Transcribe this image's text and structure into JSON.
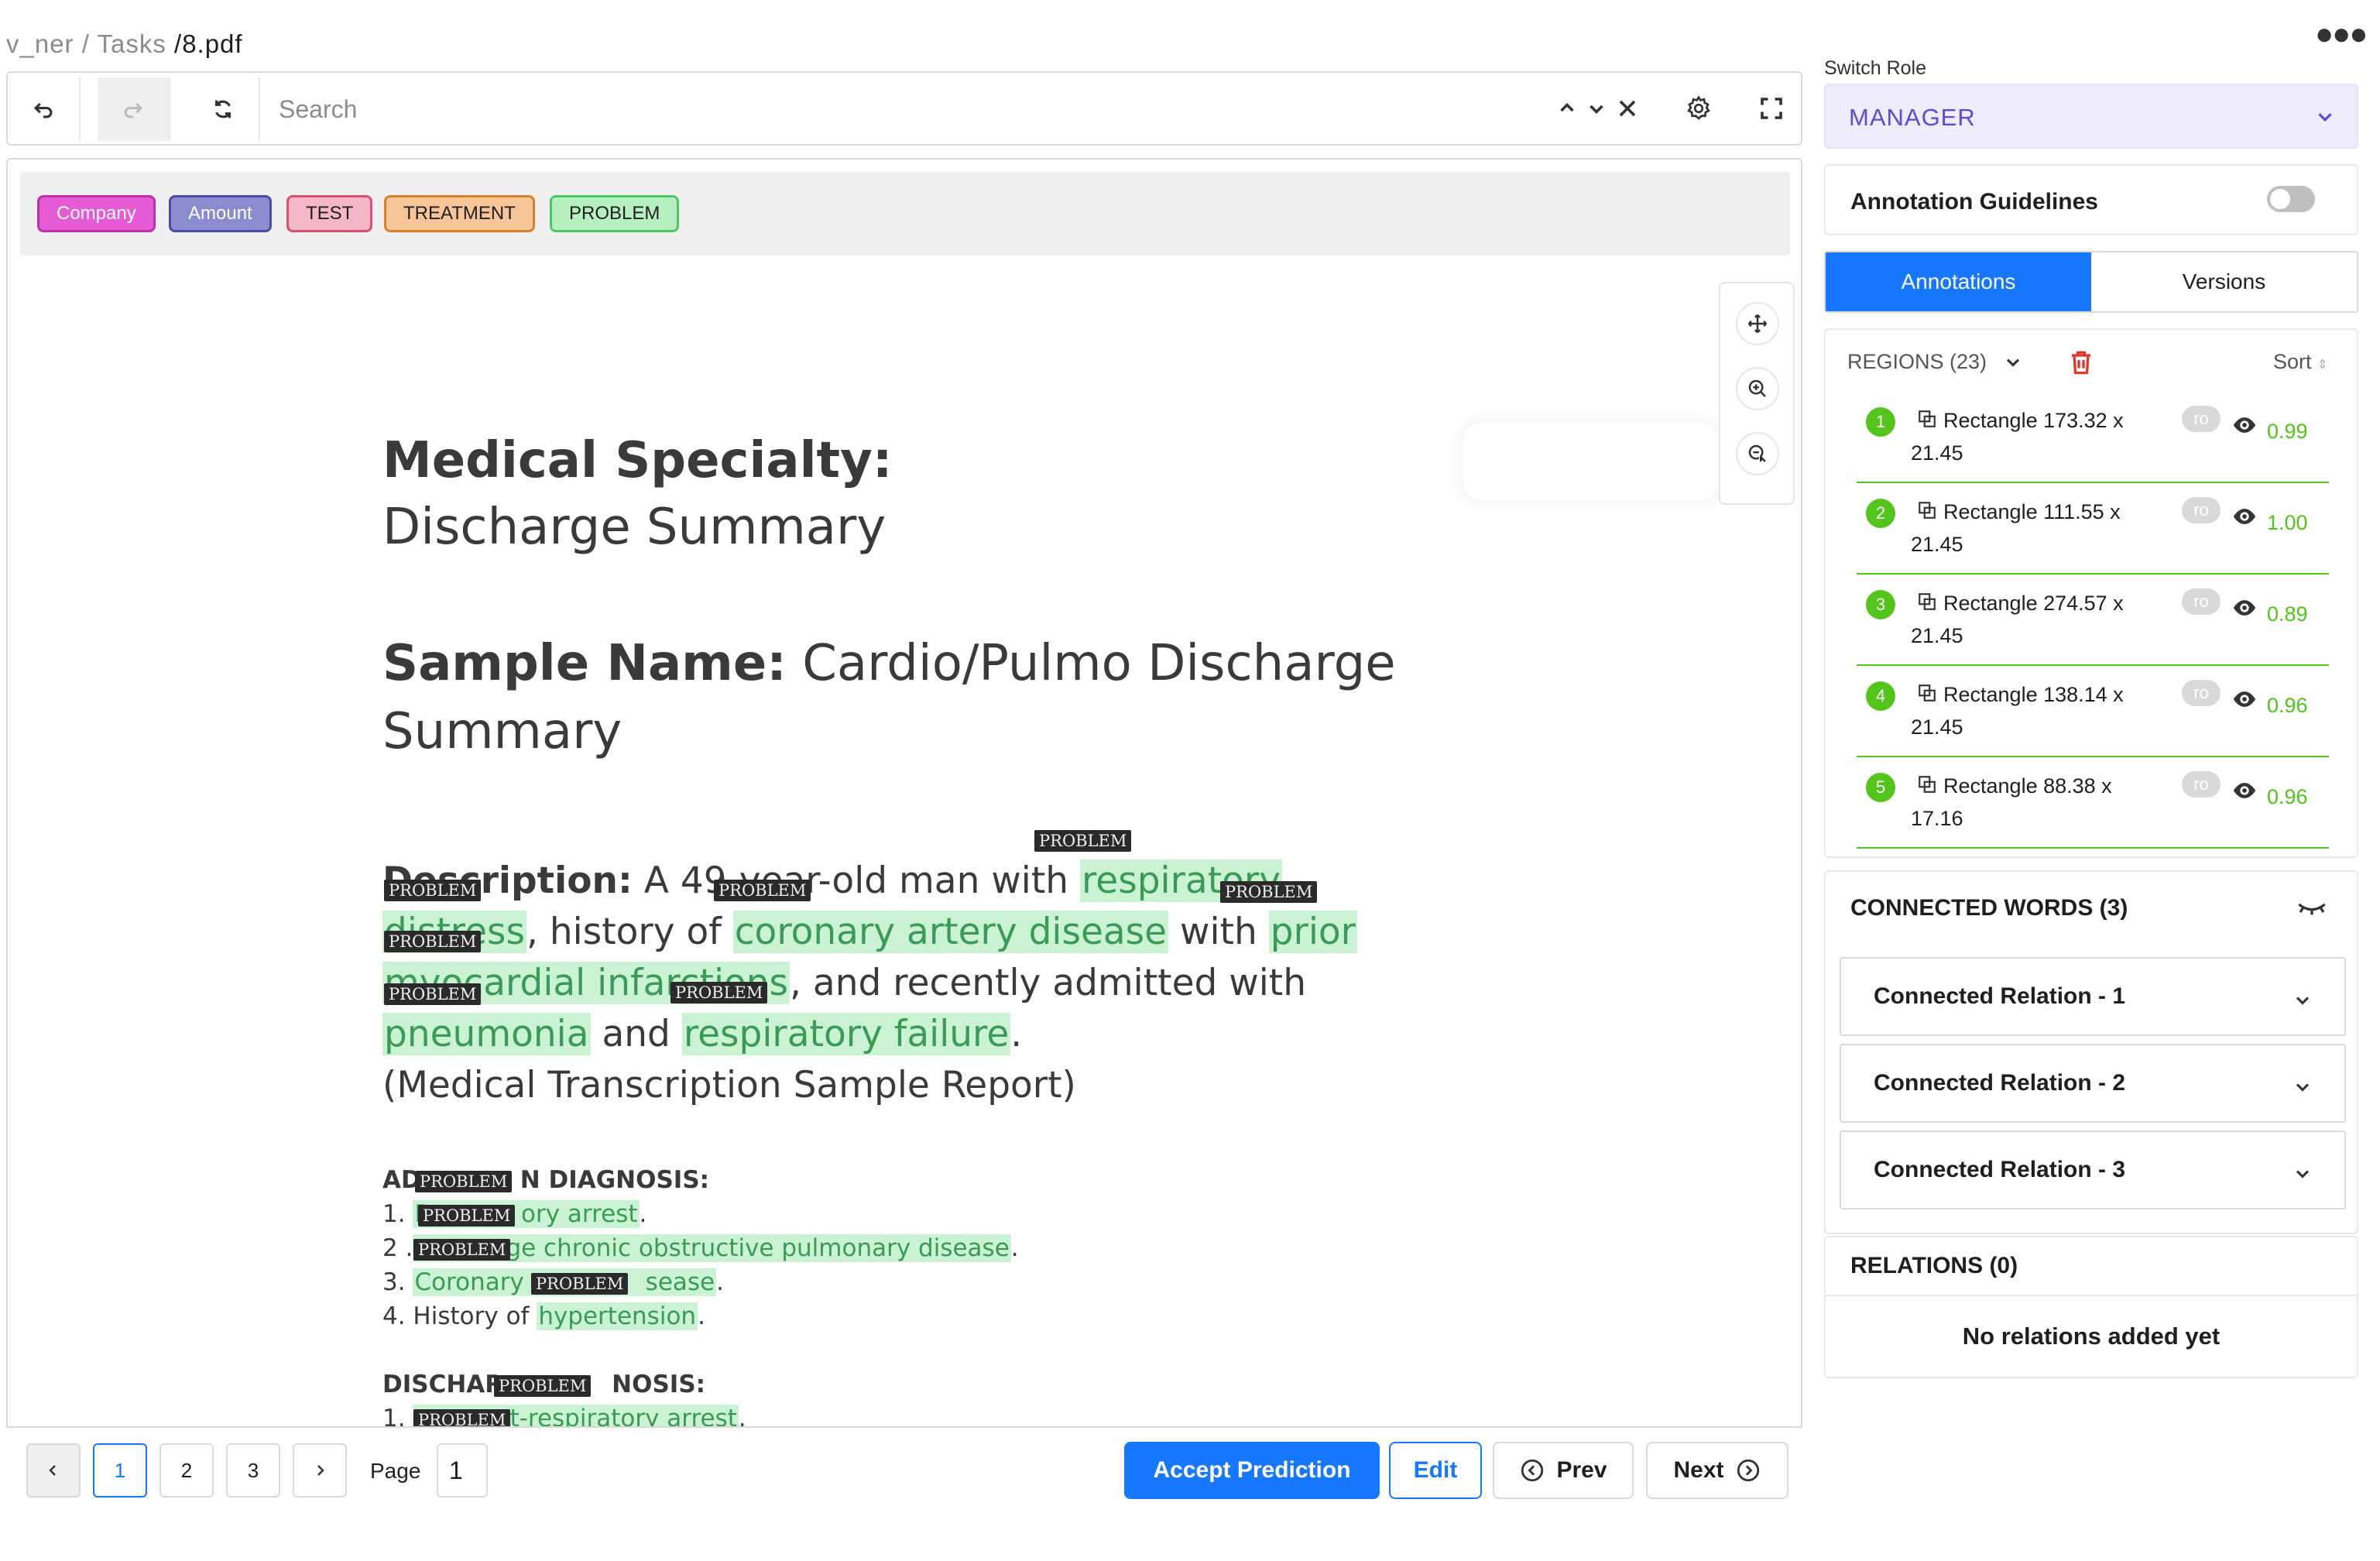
{
  "breadcrumb": {
    "project": "v_ner",
    "sep1": "/",
    "section": "Tasks",
    "sep2": "/",
    "file": "8.pdf"
  },
  "toolbar": {
    "search_placeholder": "Search"
  },
  "labels": [
    {
      "text": "Company",
      "bg": "#e55bd5",
      "border": "#b832a8",
      "color": "#ffffff"
    },
    {
      "text": "Amount",
      "bg": "#8b8bd0",
      "border": "#4b4ba6",
      "color": "#ffffff"
    },
    {
      "text": "TEST",
      "bg": "#f3b7c6",
      "border": "#d9536f",
      "color": "#1f1f1f"
    },
    {
      "text": "TREATMENT",
      "bg": "#f6c699",
      "border": "#d9822b",
      "color": "#1f1f1f"
    },
    {
      "text": "PROBLEM",
      "bg": "#b6f0c0",
      "border": "#4cc766",
      "color": "#1f1f1f"
    }
  ],
  "document": {
    "specialty_label": "Medical Specialty:",
    "specialty_value": "Discharge Summary",
    "sample_label": "Sample Name:",
    "sample_value_1": "Cardio/Pulmo Discharge",
    "sample_value_2": "Summary",
    "desc_label": "Description:",
    "desc_1a": " A 49-year-old man with ",
    "desc_1b": "respiratory",
    "desc_2a": "distress",
    "desc_2b": ", history of ",
    "desc_2c": "coronary artery disease",
    "desc_2d": " with ",
    "desc_2e": "prior",
    "desc_3a": "myocardial infarctions",
    "desc_3b": ", and recently admitted with",
    "desc_4a": "pneumonia",
    "desc_4b": " and ",
    "desc_4c": "respiratory failure",
    "desc_4d": ".",
    "desc_5": "(Medical Transcription Sample Report)",
    "adm_heading_a": "AD",
    "adm_heading_b": "N DIAGNOSIS:",
    "adm_1a": "1. ",
    "adm_1b": "R",
    "adm_1c": "ory arrest",
    "adm_1d": ".",
    "adm_2a": "2 .",
    "adm_2b": "ge chronic obstructive pulmonary disease",
    "adm_2c": ".",
    "adm_3a": "3. ",
    "adm_3b": "Coronary a",
    "adm_3c": "sease",
    "adm_3d": ".",
    "adm_4a": "4. History of ",
    "adm_4b": "hypertension",
    "adm_4c": ".",
    "dis_heading": "DISCHAR",
    "dis_heading_b": "NOSIS:",
    "dis_1a": "1. ",
    "dis_1b": "ost-respiratory arrest",
    "dis_1c": ".",
    "tag": "PROBLEM"
  },
  "pagination": {
    "pages": [
      "1",
      "2",
      "3"
    ],
    "page_label": "Page",
    "page_value": "1"
  },
  "actions": {
    "accept": "Accept Prediction",
    "edit": "Edit",
    "prev": "Prev",
    "next": "Next"
  },
  "sidebar": {
    "switch_role_label": "Switch Role",
    "role_value": "MANAGER",
    "guidelines_label": "Annotation Guidelines",
    "tabs": [
      "Annotations",
      "Versions"
    ],
    "regions_label": "REGIONS (23)",
    "sort_label": "Sort",
    "regions": [
      {
        "num": "1",
        "title": "Rectangle 173.32 x 21.45",
        "badge": "ro",
        "score": "0.99"
      },
      {
        "num": "2",
        "title": "Rectangle 111.55 x 21.45",
        "badge": "ro",
        "score": "1.00"
      },
      {
        "num": "3",
        "title": "Rectangle 274.57 x 21.45",
        "badge": "ro",
        "score": "0.89"
      },
      {
        "num": "4",
        "title": "Rectangle 138.14 x 21.45",
        "badge": "ro",
        "score": "0.96"
      },
      {
        "num": "5",
        "title": "Rectangle 88.38 x 17.16",
        "badge": "ro",
        "score": "0.96"
      }
    ],
    "connected_words_label": "CONNECTED WORDS (3)",
    "connected_relations": [
      "Connected Relation - 1",
      "Connected Relation - 2",
      "Connected Relation - 3"
    ],
    "relations_label": "RELATIONS (0)",
    "relations_empty": "No relations added yet"
  },
  "colors": {
    "accent": "#1677ff",
    "success": "#52c41a",
    "danger": "#e5332b",
    "role": "#5b4bd6"
  }
}
